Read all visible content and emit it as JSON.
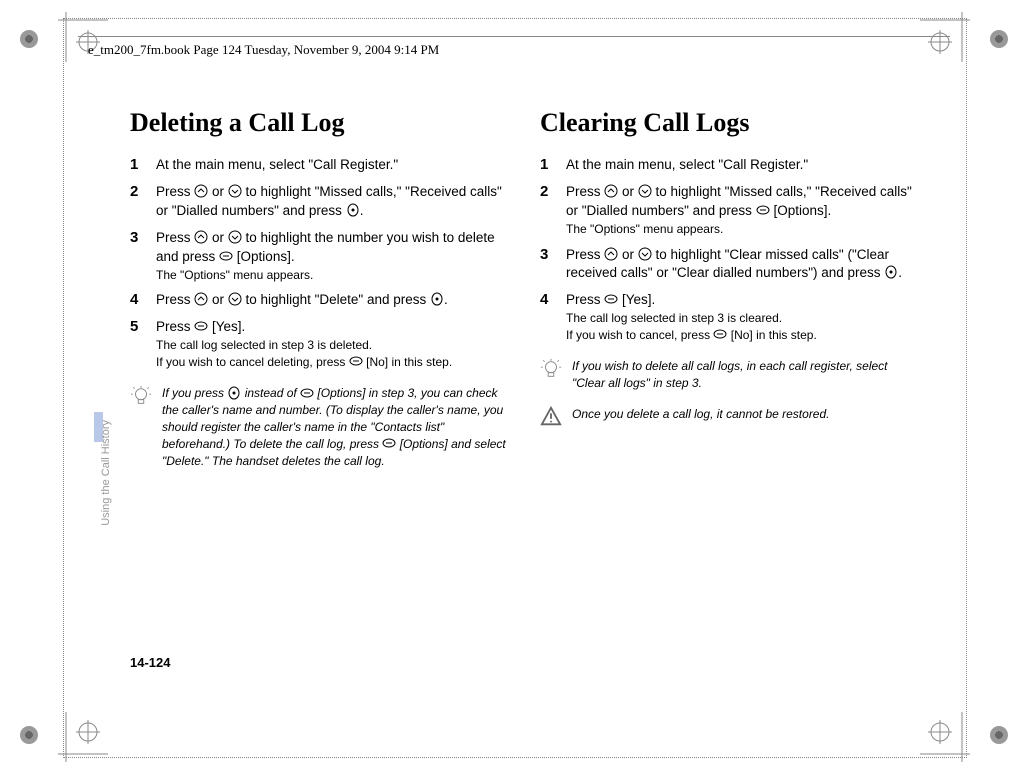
{
  "header": "e_tm200_7fm.book  Page 124  Tuesday, November 9, 2004  9:14 PM",
  "side_label": "Using the Call History",
  "page_number": "14-124",
  "left": {
    "title": "Deleting a Call Log",
    "steps": {
      "s1": "At the main menu, select \"Call Register.\"",
      "s2a": "Press ",
      "s2b": " or ",
      "s2c": " to highlight \"Missed calls,\" \"Received calls\" or \"Dialled numbers\" and press ",
      "s2d": ".",
      "s3a": "Press ",
      "s3b": " or ",
      "s3c": " to highlight the number you wish to delete and press ",
      "s3d": " [Options].",
      "s3sub": "The \"Options\" menu appears.",
      "s4a": "Press ",
      "s4b": " or ",
      "s4c": " to highlight \"Delete\" and press ",
      "s4d": ".",
      "s5a": "Press ",
      "s5b": " [Yes].",
      "s5sub1": "The call log selected in step 3 is deleted.",
      "s5sub2a": "If you wish to cancel deleting, press ",
      "s5sub2b": " [No] in this step."
    },
    "note_a": "If you press ",
    "note_b": " instead of ",
    "note_c": " [Options] in step 3, you can check the caller's name and number. (To display the caller's name, you should register the caller's name in the \"Contacts list\" beforehand.) To delete the call log, press ",
    "note_d": " [Options] and select \"Delete.\" The handset deletes the call log."
  },
  "right": {
    "title": "Clearing Call Logs",
    "steps": {
      "s1": "At the main menu, select \"Call Register.\"",
      "s2a": "Press ",
      "s2b": " or ",
      "s2c": " to highlight \"Missed calls,\" \"Received calls\" or \"Dialled numbers\" and press ",
      "s2d": " [Options].",
      "s2sub": "The \"Options\" menu appears.",
      "s3a": "Press ",
      "s3b": " or ",
      "s3c": " to highlight \"Clear missed calls\" (\"Clear received calls\" or \"Clear dialled numbers\") and press ",
      "s3d": ".",
      "s4a": "Press ",
      "s4b": " [Yes].",
      "s4sub1": "The call log selected in step 3 is cleared.",
      "s4sub2a": "If you wish to cancel, press ",
      "s4sub2b": " [No] in this step."
    },
    "note1": "If you wish to delete all call logs, in each call register, select \"Clear all logs\" in step 3.",
    "note2": "Once you delete a call log, it cannot be restored."
  }
}
